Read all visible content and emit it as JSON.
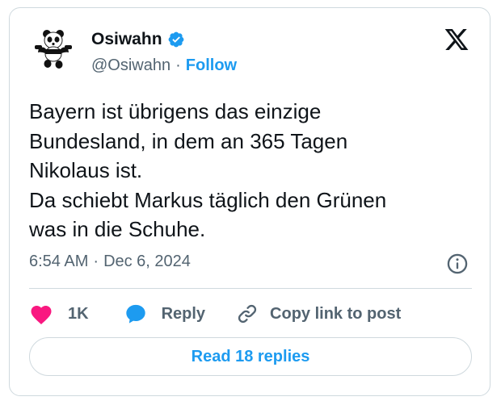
{
  "author": {
    "name": "Osiwahn",
    "handle": "@Osiwahn",
    "separator": "·",
    "follow_label": "Follow",
    "avatar_icon": "panda-avatar-icon",
    "verified_icon": "verified-badge-icon",
    "verified_color": "#1d9bf0"
  },
  "platform_icon": "x-logo-icon",
  "tweet": {
    "lines": [
      "Bayern ist übrigens das einzige",
      "Bundesland, in dem an 365 Tagen",
      "Nikolaus ist.",
      "Da schiebt Markus täglich den Grünen",
      "was in die Schuhe."
    ]
  },
  "meta": {
    "time": "6:54 AM",
    "separator": "·",
    "date": "Dec 6, 2024",
    "info_icon": "info-icon"
  },
  "actions": {
    "like_count": "1K",
    "like_icon": "heart-icon",
    "like_color": "#f91880",
    "reply_label": "Reply",
    "reply_icon": "speech-bubble-icon",
    "reply_color": "#1d9bf0",
    "copy_label": "Copy link to post",
    "copy_icon": "link-icon"
  },
  "read_replies_label": "Read 18 replies",
  "colors": {
    "accent": "#1d9bf0",
    "text_primary": "#0f1419",
    "text_secondary": "#536471",
    "border": "#cfd9de"
  }
}
